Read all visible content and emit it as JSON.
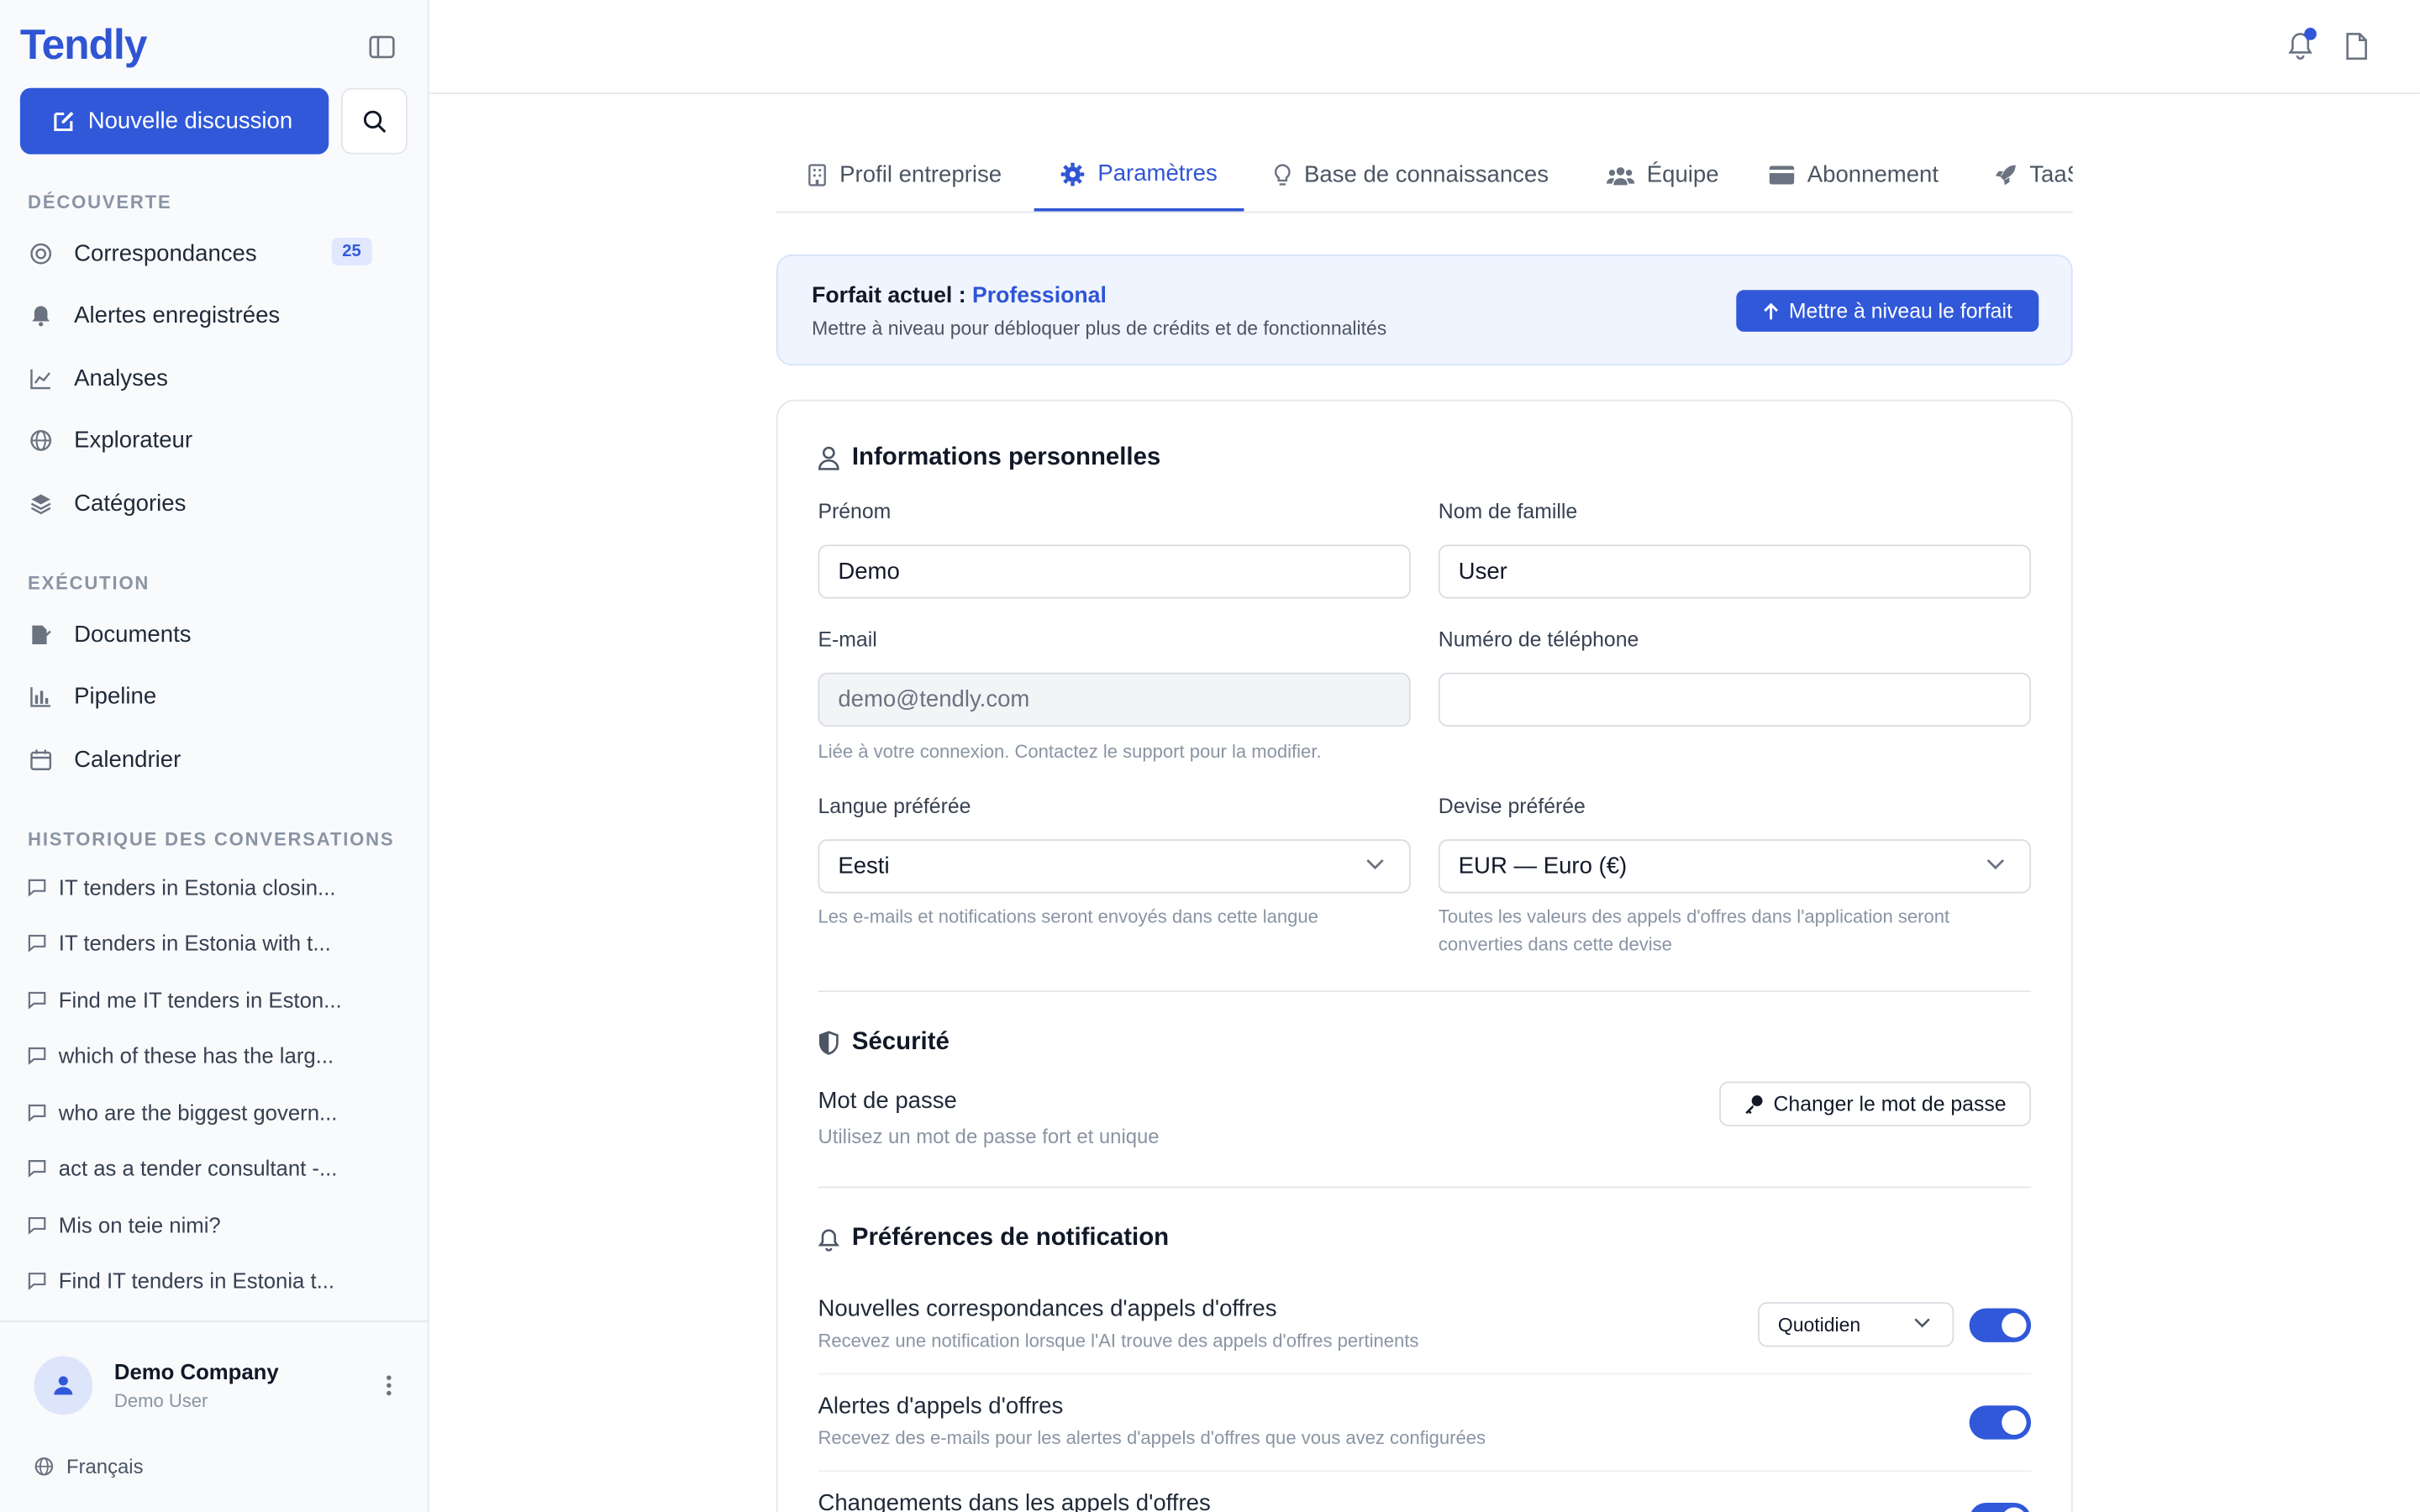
{
  "sidebar": {
    "logo": "Tendly",
    "new_chat": "Nouvelle discussion",
    "discovery_title": "DÉCOUVERTE",
    "discovery": [
      {
        "label": "Correspondances",
        "badge": "25"
      },
      {
        "label": "Alertes enregistrées"
      },
      {
        "label": "Analyses"
      },
      {
        "label": "Explorateur"
      },
      {
        "label": "Catégories"
      }
    ],
    "execution_title": "EXÉCUTION",
    "execution": [
      {
        "label": "Documents"
      },
      {
        "label": "Pipeline"
      },
      {
        "label": "Calendrier"
      }
    ],
    "history_title": "HISTORIQUE DES CONVERSATIONS",
    "history": [
      "IT tenders in Estonia closin...",
      "IT tenders in Estonia with t...",
      "Find me IT tenders in Eston...",
      "which of these has the larg...",
      "who are the biggest govern...",
      "act as a tender consultant -...",
      "Mis on teie nimi?",
      "Find IT tenders in Estonia t..."
    ],
    "company": "Demo Company",
    "user": "Demo User",
    "language": "Français"
  },
  "tabs": [
    {
      "label": "Profil entreprise"
    },
    {
      "label": "Paramètres"
    },
    {
      "label": "Base de connaissances"
    },
    {
      "label": "Équipe"
    },
    {
      "label": "Abonnement"
    },
    {
      "label": "TaaS"
    }
  ],
  "plan": {
    "title_prefix": "Forfait actuel :",
    "plan_name": "Professional",
    "subtitle": "Mettre à niveau pour débloquer plus de crédits et de fonctionnalités",
    "upgrade_label": "Mettre à niveau le forfait"
  },
  "personal": {
    "title": "Informations personnelles",
    "first_name_label": "Prénom",
    "first_name": "Demo",
    "last_name_label": "Nom de famille",
    "last_name": "User",
    "email_label": "E-mail",
    "email": "demo@tendly.com",
    "email_hint": "Liée à votre connexion. Contactez le support pour la modifier.",
    "phone_label": "Numéro de téléphone",
    "phone": "",
    "language_label": "Langue préférée",
    "language": "Eesti",
    "language_hint": "Les e-mails et notifications seront envoyés dans cette langue",
    "currency_label": "Devise préférée",
    "currency": "EUR — Euro (€)",
    "currency_hint_1": "Toutes les valeurs des appels d'offres dans l'application seront",
    "currency_hint_2": "converties dans cette devise"
  },
  "security": {
    "title": "Sécurité",
    "password_label": "Mot de passe",
    "password_hint": "Utilisez un mot de passe fort et unique",
    "change_label": "Changer le mot de passe"
  },
  "notifications": {
    "title": "Préférences de notification",
    "items": [
      {
        "title": "Nouvelles correspondances d'appels d'offres",
        "desc": "Recevez une notification lorsque l'AI trouve des appels d'offres pertinents",
        "frequency": "Quotidien",
        "enabled": true
      },
      {
        "title": "Alertes d'appels d'offres",
        "desc": "Recevez des e-mails pour les alertes d'appels d'offres que vous avez configurées",
        "enabled": true
      },
      {
        "title": "Changements dans les appels d'offres",
        "desc": "",
        "enabled": true
      }
    ]
  },
  "colors": {
    "accent": "#3058d9",
    "sidebar_bg": "#f8fafc"
  }
}
